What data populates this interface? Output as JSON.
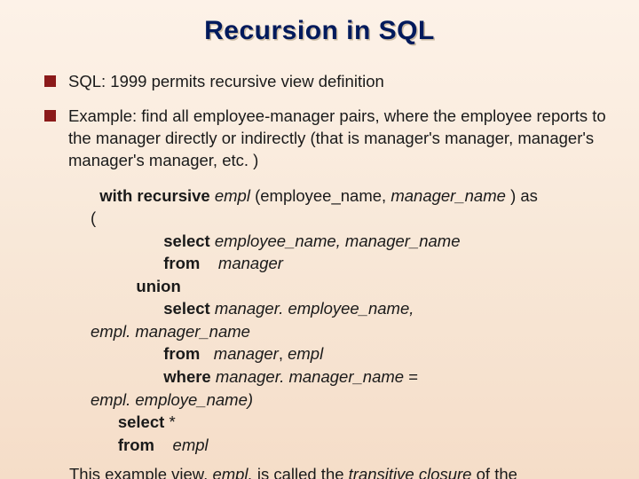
{
  "title": "Recursion in SQL",
  "bullets": [
    "SQL: 1999 permits recursive view definition",
    "Example: find all employee-manager pairs, where the employee reports to the manager directly or indirectly (that is manager's manager, manager's manager's manager, etc. )"
  ],
  "code": {
    "l1a": "  ",
    "l1b": "with recursive",
    "l1c": " empl ",
    "l1d": "(employee_name, ",
    "l1e": "manager_name ",
    "l1f": ") as",
    "l2": "(",
    "l3a": "                ",
    "l3b": "select ",
    "l3c": "employee_name, manager_name",
    "l4a": "                ",
    "l4b": "from",
    "l4c": "    manager",
    "l5a": "          ",
    "l5b": "union",
    "l6a": "                ",
    "l6b": "select ",
    "l6c": "manager.",
    "l6d": " employee_name, ",
    "l7": "empl. manager_name",
    "l8a": "                ",
    "l8b": "from",
    "l8c": "   manager",
    "l8d": ", ",
    "l8e": "empl",
    "l9a": "                ",
    "l9b": "where ",
    "l9c": "manager",
    "l9d": ". manager_name ",
    "l9e": "= ",
    "l10": "empl. employe_name)",
    "l11a": "      ",
    "l11b": "select",
    "l11c": " *",
    "l12a": "      ",
    "l12b": "from",
    "l12c": "    empl"
  },
  "footer": {
    "a": "This example view, ",
    "b": "empl, ",
    "c": "is called the ",
    "d": "transitive closure ",
    "e": "of the"
  }
}
